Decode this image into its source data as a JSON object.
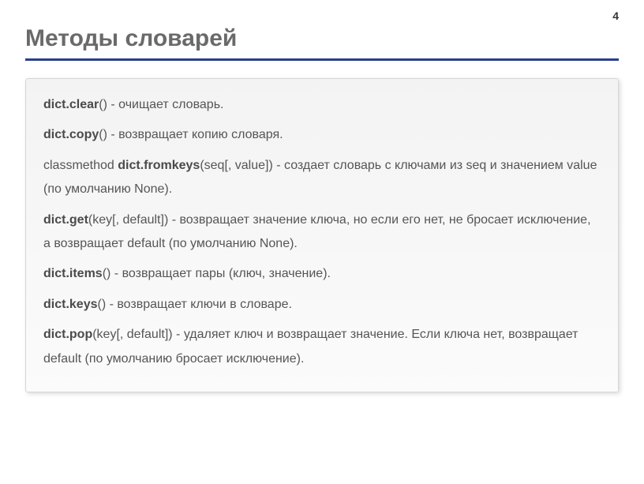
{
  "page_number": "4",
  "title": "Методы словарей",
  "methods": [
    {
      "prefix": "",
      "name": "dict.clear",
      "signature": "() - очищает словарь."
    },
    {
      "prefix": "",
      "name": "dict.copy",
      "signature": "() - возвращает копию словаря."
    },
    {
      "prefix": "classmethod ",
      "name": "dict.fromkeys",
      "signature": "(seq[, value]) - создает словарь с ключами из seq и значением value (по умолчанию None)."
    },
    {
      "prefix": "",
      "name": "dict.get",
      "signature": "(key[, default]) - возвращает значение ключа, но если его нет, не бросает исключение, а возвращает default (по умолчанию None)."
    },
    {
      "prefix": "",
      "name": "dict.items",
      "signature": "() - возвращает пары (ключ, значение)."
    },
    {
      "prefix": "",
      "name": "dict.keys",
      "signature": "() - возвращает ключи в словаре."
    },
    {
      "prefix": "",
      "name": "dict.pop",
      "signature": "(key[, default]) - удаляет ключ и возвращает значение. Если ключа нет, возвращает default (по умолчанию бросает исключение)."
    }
  ]
}
